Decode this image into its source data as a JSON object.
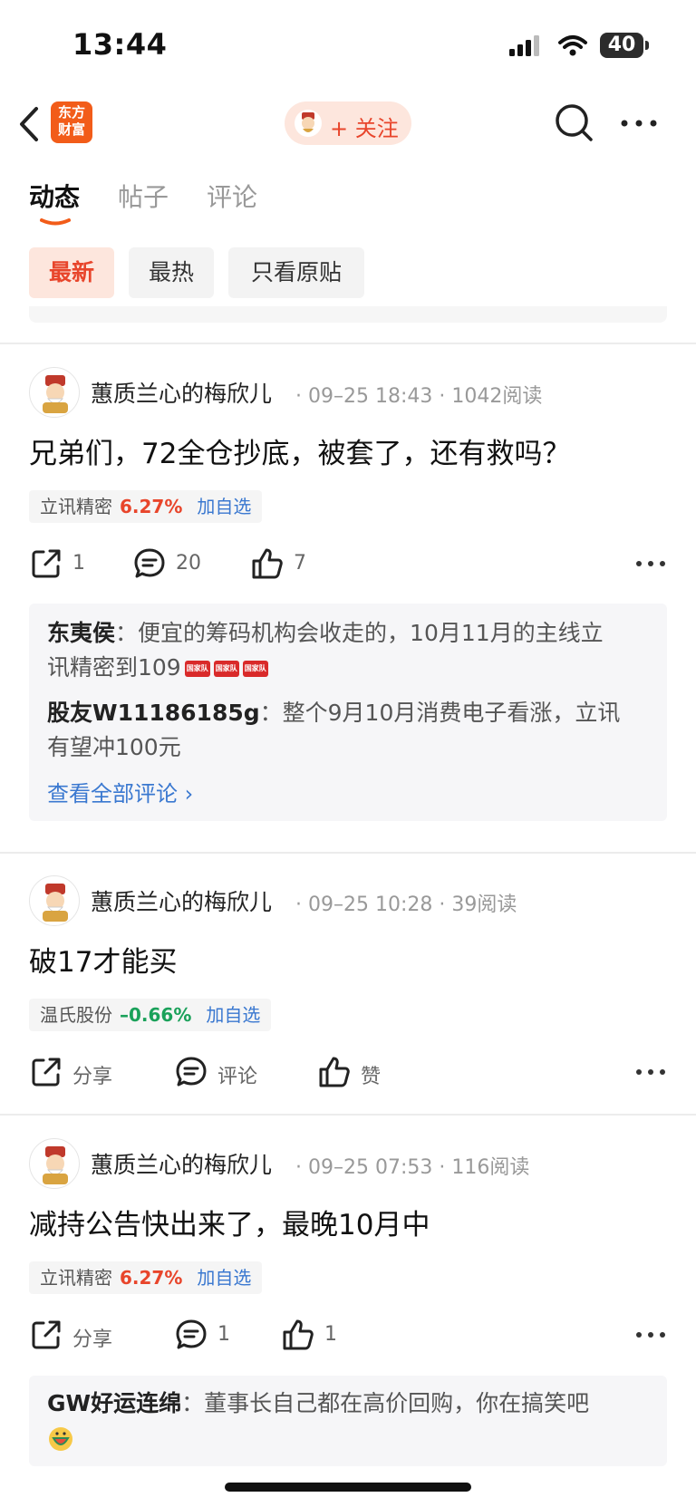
{
  "status_bar": {
    "time": "13:44",
    "battery": "40"
  },
  "header": {
    "app_logo_line1": "东方",
    "app_logo_line2": "财富",
    "follow_label": "+ 关注"
  },
  "tabs": [
    {
      "label": "动态",
      "active": true
    },
    {
      "label": "帖子",
      "active": false
    },
    {
      "label": "评论",
      "active": false
    }
  ],
  "filters": [
    {
      "label": "最新",
      "active": true
    },
    {
      "label": "最热",
      "active": false
    },
    {
      "label": "只看原贴",
      "active": false
    }
  ],
  "posts": [
    {
      "author": "蕙质兰心的梅欣儿",
      "meta": "· 09–25 18:43 · 1042阅读",
      "text": "兄弟们，72全仓抄底，被套了，还有救吗？",
      "stock": {
        "name": "立讯精密",
        "change": "6.27%",
        "add": "加自选"
      },
      "actions": {
        "share": "1",
        "comment": "20",
        "like": "7"
      },
      "comments": [
        {
          "author": "东夷侯",
          "sep": "：",
          "text_line1": "便宜的筹码机构会收走的，10月11月的主线立",
          "text_line2": "讯精密到109",
          "badge": "国家队"
        },
        {
          "author": "股友W11186185g",
          "sep": "：",
          "text_line1": "整个9月10月消费电子看涨，立讯",
          "text_line2": "有望冲100元"
        }
      ],
      "view_all": "查看全部评论 ›"
    },
    {
      "author": "蕙质兰心的梅欣儿",
      "meta": "· 09–25 10:28 · 39阅读",
      "text": "破17才能买",
      "stock": {
        "name": "温氏股份",
        "change": "–0.66%",
        "add": "加自选"
      },
      "actions": {
        "share": "分享",
        "comment": "评论",
        "like": "赞"
      }
    },
    {
      "author": "蕙质兰心的梅欣儿",
      "meta": "· 09–25 07:53 · 116阅读",
      "text": "减持公告快出来了，最晚10月中",
      "stock": {
        "name": "立讯精密",
        "change": "6.27%",
        "add": "加自选"
      },
      "actions": {
        "share": "分享",
        "comment": "1",
        "like": "1"
      },
      "comments": [
        {
          "author": "GW好运连绵",
          "sep": "：",
          "text_line1": "董事长自己都在高价回购，你在搞笑吧"
        }
      ]
    }
  ],
  "colors": {
    "accent": "#e8452b",
    "link": "#3a78d0",
    "down": "#1aa15a"
  }
}
